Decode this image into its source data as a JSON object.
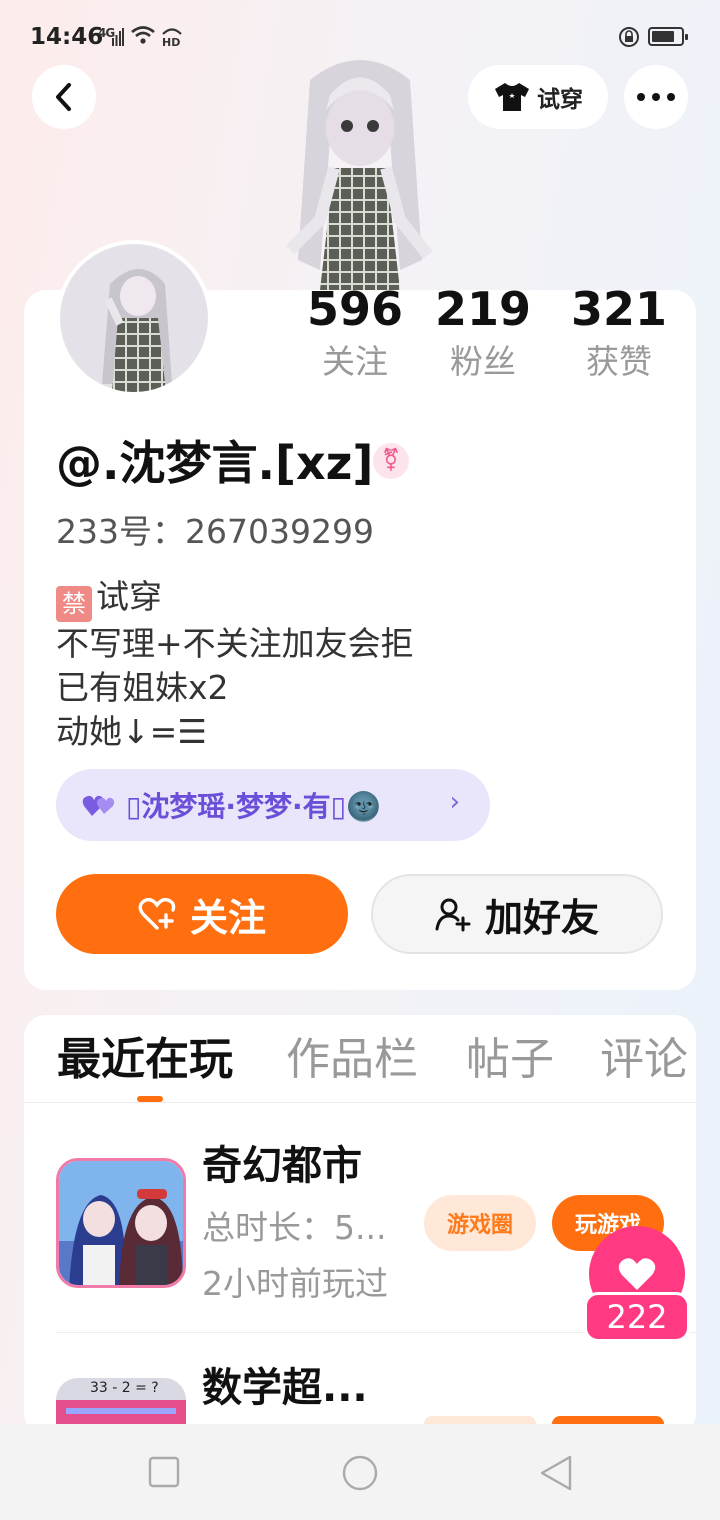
{
  "status_bar": {
    "time": "14:46",
    "network": "4G",
    "hd": "HD"
  },
  "header": {
    "tryon_label": "试穿"
  },
  "stats": [
    {
      "value": "596",
      "label": "关注"
    },
    {
      "value": "219",
      "label": "粉丝"
    },
    {
      "value": "321",
      "label": "获赞"
    }
  ],
  "profile": {
    "username": "@.沈梦言.[xz]",
    "gender_symbol": "⚧",
    "uid": "233号：267039299",
    "bio_ban": "禁",
    "bio_lines": [
      "试穿",
      "不写理+不关注加友会拒",
      "已有姐妹x2",
      "动她↓=☰"
    ],
    "relation_text": "▯沈梦瑶·梦梦·有▯🌚"
  },
  "actions": {
    "follow_label": "关注",
    "add_friend_label": "加好友"
  },
  "tabs": [
    "最近在玩",
    "作品栏",
    "帖子",
    "评论"
  ],
  "games": [
    {
      "name": "奇幻都市",
      "duration": "总时长：5...",
      "last_played": "2小时前玩过",
      "circle_label": "游戏圈",
      "play_label": "玩游戏"
    },
    {
      "name": "数学超...",
      "icon_text": "33 - 2 = ?"
    }
  ],
  "like": {
    "count": "222"
  },
  "colors": {
    "accent": "#ff6f0f",
    "like": "#ff3a82",
    "relation": "#6b4fd8"
  }
}
